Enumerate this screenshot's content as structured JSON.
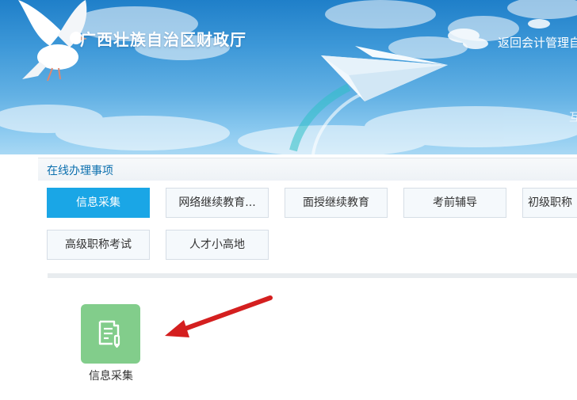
{
  "header": {
    "site_title": "广西壮族自治区财政厅",
    "return_link": "返回会计管理自",
    "right_char": "互"
  },
  "section": {
    "title": "在线办理事项"
  },
  "tabs": [
    {
      "label": "信息采集",
      "active": true
    },
    {
      "label": "网络继续教育...",
      "active": false
    },
    {
      "label": "面授继续教育",
      "active": false
    },
    {
      "label": "考前辅导",
      "active": false
    },
    {
      "label": "初级职称",
      "active": false
    },
    {
      "label": "高级职称考试",
      "active": false
    },
    {
      "label": "人才小高地",
      "active": false
    }
  ],
  "apps": [
    {
      "label": "信息采集",
      "icon": "document-pen-icon",
      "color": "#82cd8b"
    }
  ],
  "annotation": {
    "icon": "red-arrow-icon",
    "color": "#d41f1f"
  },
  "colors": {
    "accent": "#1aa6e6",
    "section_title": "#0b6fae",
    "banner_sky": "#3d98d8"
  }
}
